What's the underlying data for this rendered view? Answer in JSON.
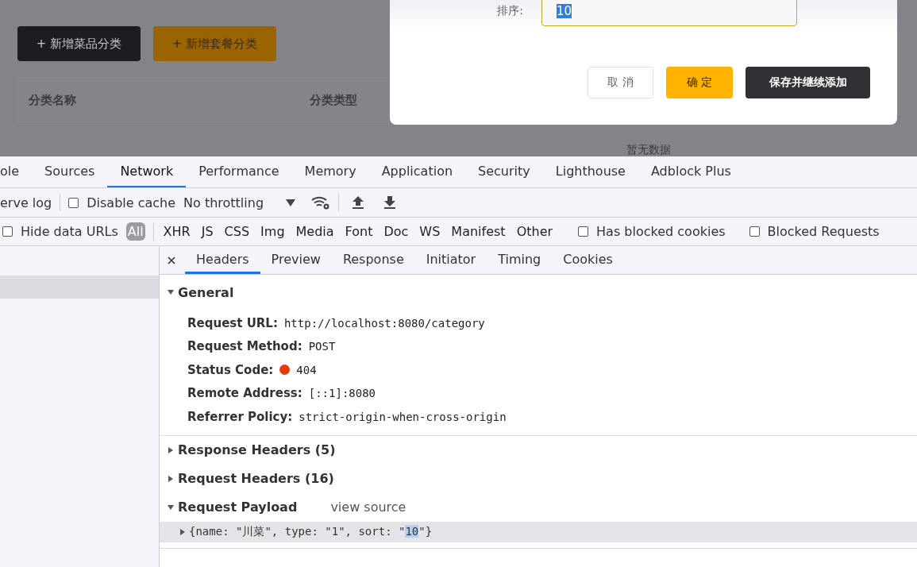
{
  "page": {
    "buttons": [
      {
        "label": "+ 新增菜品分类",
        "kind": "dark"
      },
      {
        "label": "+ 新增套餐分类",
        "kind": "orange"
      }
    ],
    "table": {
      "columns": [
        "分类名称",
        "分类类型"
      ],
      "empty_text": "暂无数据"
    }
  },
  "dialog": {
    "field_label": "排序:",
    "field_value": "10",
    "value_selected": true,
    "buttons": [
      {
        "label": "取 消",
        "kind": "plain"
      },
      {
        "label": "确 定",
        "kind": "primary"
      },
      {
        "label": "保存并继续添加",
        "kind": "dark"
      }
    ]
  },
  "devtools": {
    "tabs": [
      {
        "label": "ole",
        "selected": false
      },
      {
        "label": "Sources",
        "selected": false
      },
      {
        "label": "Network",
        "selected": true
      },
      {
        "label": "Performance",
        "selected": false
      },
      {
        "label": "Memory",
        "selected": false
      },
      {
        "label": "Application",
        "selected": false
      },
      {
        "label": "Security",
        "selected": false
      },
      {
        "label": "Lighthouse",
        "selected": false
      },
      {
        "label": "Adblock Plus",
        "selected": false
      }
    ],
    "toolbar": {
      "preserve_log": "erve log",
      "disable_cache": {
        "label": "Disable cache",
        "checked": false
      },
      "throttling": "No throttling"
    },
    "filters": {
      "hide_data_urls": {
        "label": "Hide data URLs",
        "checked": false
      },
      "types": [
        {
          "label": "All",
          "selected": true
        },
        {
          "label": "XHR",
          "selected": false
        },
        {
          "label": "JS",
          "selected": false
        },
        {
          "label": "CSS",
          "selected": false
        },
        {
          "label": "Img",
          "selected": false
        },
        {
          "label": "Media",
          "selected": false
        },
        {
          "label": "Font",
          "selected": false
        },
        {
          "label": "Doc",
          "selected": false
        },
        {
          "label": "WS",
          "selected": false
        },
        {
          "label": "Manifest",
          "selected": false
        },
        {
          "label": "Other",
          "selected": false
        }
      ],
      "options": [
        {
          "label": "Has blocked cookies",
          "checked": false
        },
        {
          "label": "Blocked Requests",
          "checked": false
        }
      ]
    },
    "detail_tabs": [
      {
        "label": "Headers",
        "selected": true
      },
      {
        "label": "Preview",
        "selected": false
      },
      {
        "label": "Response",
        "selected": false
      },
      {
        "label": "Initiator",
        "selected": false
      },
      {
        "label": "Timing",
        "selected": false
      },
      {
        "label": "Cookies",
        "selected": false
      }
    ],
    "general": {
      "title": "General",
      "expanded": true,
      "rows": [
        {
          "key": "Request URL:",
          "value": "http://localhost:8080/category"
        },
        {
          "key": "Request Method:",
          "value": "POST"
        },
        {
          "key": "Status Code:",
          "value": "404",
          "color": "#e8380d"
        },
        {
          "key": "Remote Address:",
          "value": "[::1]:8080"
        },
        {
          "key": "Referrer Policy:",
          "value": "strict-origin-when-cross-origin"
        }
      ]
    },
    "sections": [
      {
        "title": "Response Headers (5)",
        "expanded": false
      },
      {
        "title": "Request Headers (16)",
        "expanded": false
      }
    ],
    "payload": {
      "title": "Request Payload",
      "expanded": true,
      "link": "view source",
      "object_expanded": false,
      "before": "{name: \"川菜\", type: \"1\", sort: \"",
      "selected_text": "10",
      "after": "\"}"
    }
  }
}
